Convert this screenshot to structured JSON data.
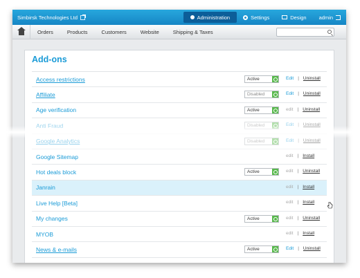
{
  "topbar": {
    "brand": "Simbirsk Technologies Ltd",
    "tabs": [
      {
        "label": "Administration",
        "icon": "admin-icon",
        "active": true
      },
      {
        "label": "Settings",
        "icon": "settings-icon"
      },
      {
        "label": "Design",
        "icon": "design-icon"
      }
    ],
    "user": "admin"
  },
  "nav": {
    "items": [
      "Orders",
      "Products",
      "Customers",
      "Website",
      "Shipping & Taxes"
    ]
  },
  "page": {
    "title": "Add-ons"
  },
  "addons": [
    {
      "name": "Access restrictions",
      "link": true,
      "status": "Active",
      "edit": "Edit",
      "action": "Uninstall"
    },
    {
      "name": "Affiliate",
      "link": true,
      "status": "Disabled",
      "edit": "Edit",
      "action": "Uninstall"
    },
    {
      "name": "Age verification",
      "link": false,
      "status": "Active",
      "edit": "edit",
      "action": "Uninstall"
    },
    {
      "name": "Anti Fraud",
      "link": false,
      "status": "Disabled",
      "edit": "Edit",
      "action": "Uninstall"
    },
    {
      "name": "Google Analytics",
      "link": true,
      "status": "Disabled",
      "edit": "Edit",
      "action": "Uninstall"
    },
    {
      "name": "Google Sitemap",
      "link": false,
      "status": "",
      "edit": "edit",
      "action": "Install"
    },
    {
      "name": "Hot deals block",
      "link": false,
      "status": "Active",
      "edit": "edit",
      "action": "Uninstall"
    },
    {
      "name": "Janrain",
      "link": false,
      "status": "",
      "edit": "edit",
      "action": "Install"
    },
    {
      "name": "Live Help [Beta]",
      "link": false,
      "status": "",
      "edit": "edit",
      "action": "Install"
    },
    {
      "name": "My changes",
      "link": false,
      "status": "Active",
      "edit": "edit",
      "action": "Uninstall"
    },
    {
      "name": "MYOB",
      "link": false,
      "status": "",
      "edit": "edit",
      "action": "Install"
    },
    {
      "name": "News & e-mails",
      "link": true,
      "status": "Active",
      "edit": "Edit",
      "action": "Uninstall"
    }
  ],
  "separator": "|",
  "colors": {
    "accent": "#1a9bd7",
    "topbar": "#1686c5",
    "active_toggle": "#58b94c",
    "hover_row": "#daf1fb"
  }
}
